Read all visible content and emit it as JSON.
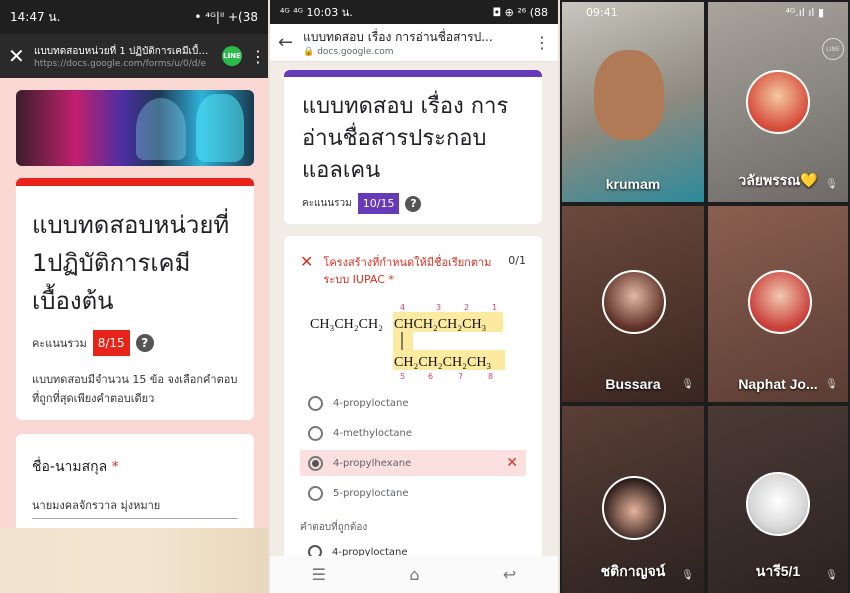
{
  "panel1": {
    "status": {
      "time": "14:47 น.",
      "right": "• ⁴ᴳ|ᴵˡ +(38"
    },
    "browser": {
      "title": "แบบทดสอบหน่วยที่ 1 ปฏิบัติการเคมีเบื้องต้น",
      "url": "https://docs.google.com/forms/u/0/d/e",
      "line": "LINE"
    },
    "form": {
      "title": "แบบทดสอบหน่วยที่ 1ปฏิบัติการเคมีเบื้องต้น",
      "score_label": "คะแนนรวม",
      "score": "8/15",
      "description": "แบบทดสอบมีจำนวน 15 ข้อ จงเลือกคำตอบที่ถูกที่สุดเพียงคำตอบเดียว",
      "question": "ชื่อ-นามสกุล",
      "required_mark": "*",
      "answer": "นายมงคลจักรวาล มุ่งหมาย"
    },
    "colors": {
      "accent": "#e8231a"
    }
  },
  "panel2": {
    "status": {
      "time": "⁴ᴳ ⁴ᴳ 10:03 น.",
      "right": "◘ ⊕ ²⁶ (88"
    },
    "browser": {
      "title": "แบบทดสอบ เรื่อง การอ่านชื่อสารป...",
      "url": "docs.google.com"
    },
    "form": {
      "title": "แบบทดสอบ เรื่อง การอ่านชื่อสารประกอบแอลเคน",
      "score_label": "คะแนนรวม",
      "score": "10/15",
      "question": "โครงสร้างที่กำหนดให้มีชื่อเรียกตามระบบ IUPAC *",
      "points": "0/1",
      "formula": {
        "top_prefix": "CH₃CH₂CH₂",
        "top_hl": "CHCH₂CH₂CH₃",
        "bottom_hl": "CH₂CH₂CH₂CH₃",
        "top_numbers": [
          "4",
          "3",
          "2",
          "1"
        ],
        "bottom_numbers": [
          "5",
          "6",
          "7",
          "8"
        ]
      },
      "options": [
        "4-propyloctane",
        "4-methyloctane",
        "4-propylhexane",
        "5-propyloctane"
      ],
      "selected_index": 2,
      "correct_label": "คำตอบที่ถูกต้อง",
      "correct_answer": "4-propyloctane"
    },
    "colors": {
      "accent": "#673ab7",
      "error": "#d93025"
    }
  },
  "panel3": {
    "status": {
      "time": "09:41",
      "right": "⁴ᴳ.ıl ıl ▮"
    },
    "line": "LINE",
    "participants": [
      {
        "name": "krumam"
      },
      {
        "name": "วลัยพรรณ",
        "suffix": "💛"
      },
      {
        "name": "Bussara"
      },
      {
        "name": "Naphat Jo..."
      },
      {
        "name": "ชติกาญจน์"
      },
      {
        "name": "นารี5/1"
      }
    ]
  }
}
